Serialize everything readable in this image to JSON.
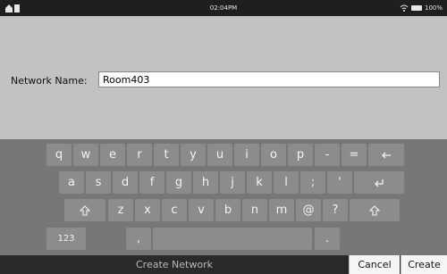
{
  "status_bar": {
    "time": "02:04PM",
    "battery": "100%"
  },
  "form": {
    "label": "Network Name:",
    "value": "Room403"
  },
  "keyboard": {
    "row1": [
      "q",
      "w",
      "e",
      "r",
      "t",
      "y",
      "u",
      "i",
      "o",
      "p",
      "-",
      "="
    ],
    "row2": [
      "a",
      "s",
      "d",
      "f",
      "g",
      "h",
      "j",
      "k",
      "l",
      ";",
      "'"
    ],
    "row3": [
      "z",
      "x",
      "c",
      "v",
      "b",
      "n",
      "m",
      "@",
      "?"
    ],
    "numbers_key": "123",
    "comma_key": ",",
    "period_key": "."
  },
  "bottom_bar": {
    "title": "Create Network",
    "cancel_label": "Cancel",
    "create_label": "Create"
  }
}
